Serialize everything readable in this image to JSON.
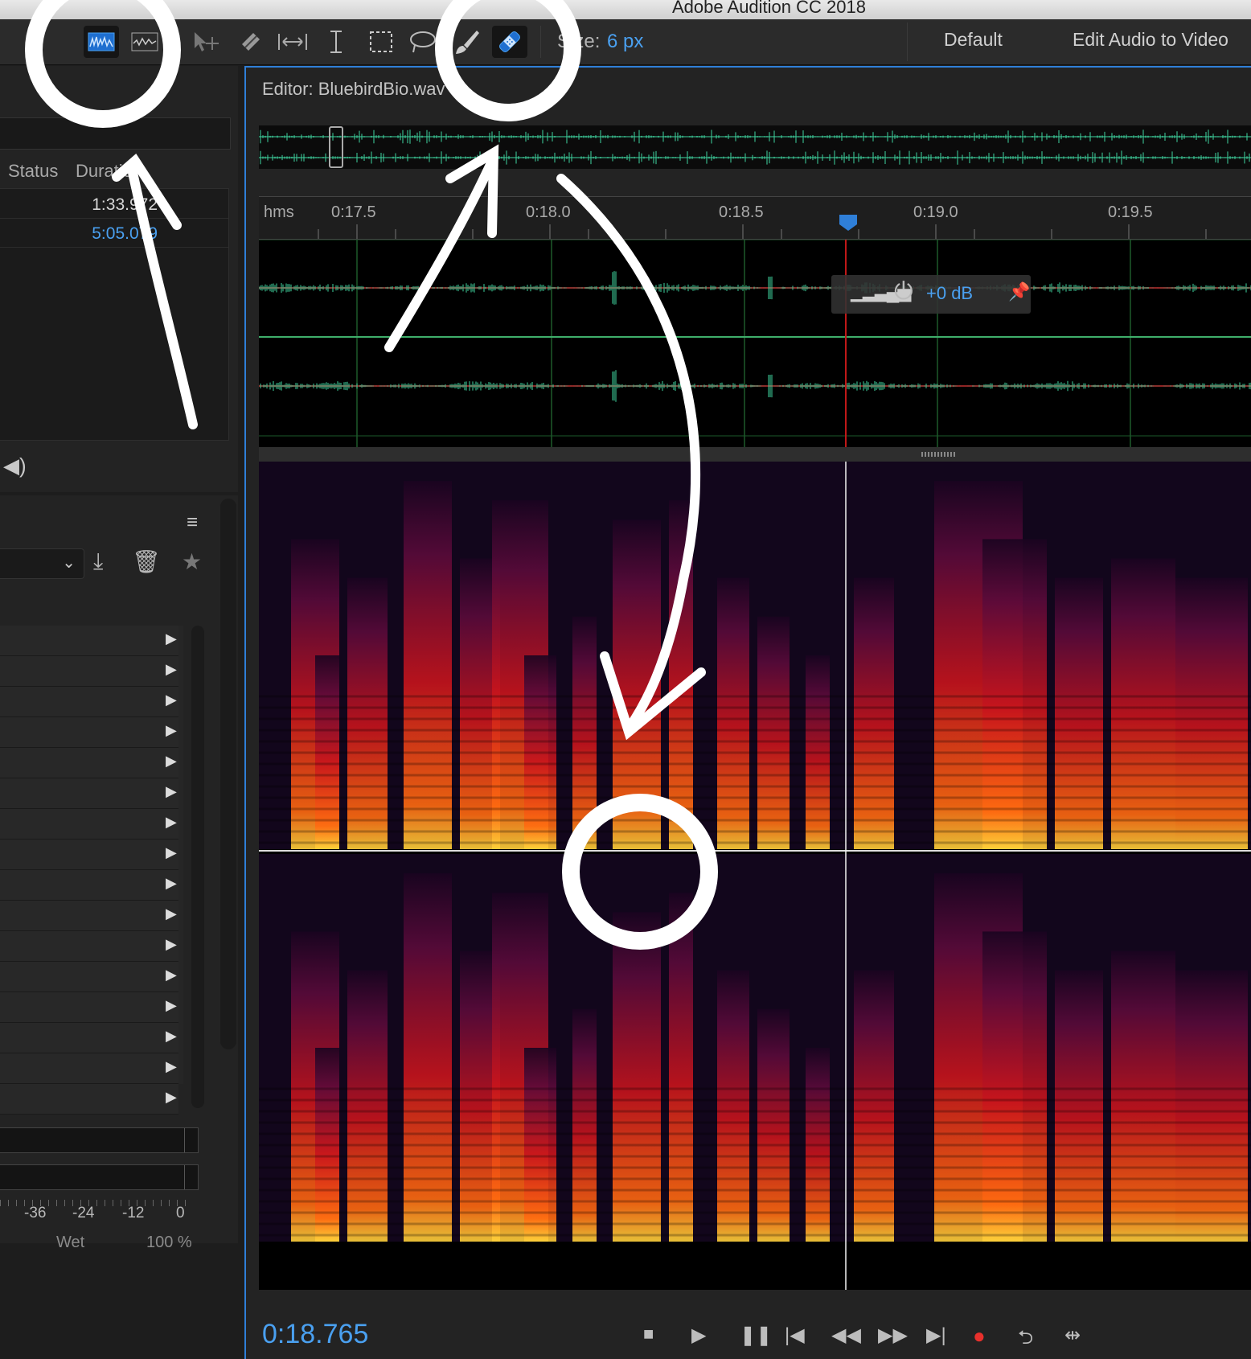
{
  "app_title": "Adobe Audition CC 2018",
  "toolbar": {
    "tools": [
      {
        "name": "waveform-view-icon",
        "active": true
      },
      {
        "name": "spectral-view-icon",
        "active": false
      },
      {
        "name": "move-tool-icon",
        "active": false
      },
      {
        "name": "razor-tool-icon",
        "active": false
      },
      {
        "name": "slip-tool-icon",
        "active": false
      },
      {
        "name": "time-selection-tool-icon",
        "active": false
      },
      {
        "name": "marquee-tool-icon",
        "active": false
      },
      {
        "name": "lasso-tool-icon",
        "active": false
      },
      {
        "name": "paintbrush-tool-icon",
        "active": false
      },
      {
        "name": "spot-healing-brush-icon",
        "active": true
      }
    ],
    "size_label": "Size:",
    "size_value": "6 px",
    "workspaces": [
      "Default",
      "Edit Audio to Video"
    ]
  },
  "files_panel": {
    "columns": [
      "Status",
      "Duration"
    ],
    "rows": [
      {
        "duration": "1:33.972",
        "color": "#d6d6d6"
      },
      {
        "duration": "5:05.079",
        "color": "#4aa0f0"
      }
    ]
  },
  "effects_rack": {
    "slot_count": 16,
    "db_scale": [
      "-36",
      "-24",
      "-12",
      "0"
    ],
    "wet_label": "Wet",
    "wet_value": "100 %"
  },
  "editor": {
    "title": "Editor: BluebirdBio.wav",
    "ruler_unit": "hms",
    "ruler_ticks": [
      "0:17.5",
      "0:18.0",
      "0:18.5",
      "0:19.0",
      "0:19.5"
    ],
    "hud_gain": "+0 dB",
    "playhead_time": "0:18.765"
  },
  "transport": [
    "stop-icon",
    "play-icon",
    "pause-icon",
    "go-to-start-icon",
    "rewind-icon",
    "fast-forward-icon",
    "go-to-end-icon",
    "record-icon",
    "loop-icon",
    "skip-selection-icon"
  ],
  "colors": {
    "accent": "#4aa0f0",
    "waveform": "#3fd6a0",
    "playhead": "#c01818",
    "record": "#e8302c"
  }
}
